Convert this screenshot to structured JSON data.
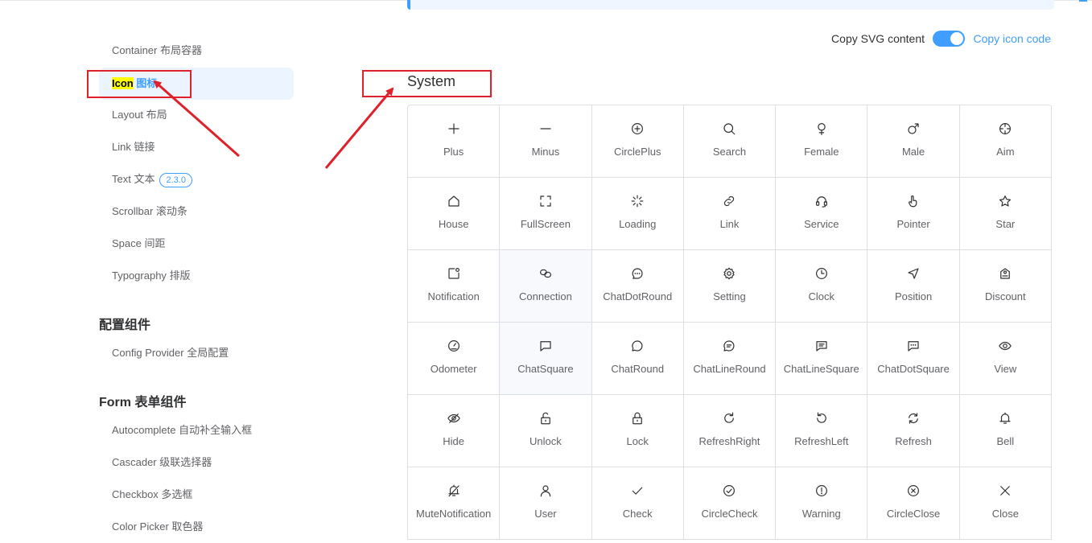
{
  "sidebar": {
    "items_top": [
      {
        "label": "Container 布局容器"
      },
      {
        "label_hl": "Icon",
        "label_rest": " 图标"
      },
      {
        "label": "Layout 布局"
      },
      {
        "label": "Link 链接"
      },
      {
        "label": "Text 文本",
        "badge": "2.3.0"
      },
      {
        "label": "Scrollbar 滚动条"
      },
      {
        "label": "Space 间距"
      },
      {
        "label": "Typography 排版"
      }
    ],
    "group_config": "配置组件",
    "config_items": [
      {
        "label": "Config Provider 全局配置"
      }
    ],
    "group_form": "Form 表单组件",
    "form_items": [
      {
        "label": "Autocomplete 自动补全输入框"
      },
      {
        "label": "Cascader 级联选择器"
      },
      {
        "label": "Checkbox 多选框"
      },
      {
        "label": "Color Picker 取色器"
      }
    ]
  },
  "copy_bar": {
    "copy_svg_label": "Copy SVG content",
    "copy_code_label": "Copy icon code",
    "toggle_on": true
  },
  "section_title": "System",
  "icons": [
    {
      "name": "Plus",
      "icon": "plus-icon"
    },
    {
      "name": "Minus",
      "icon": "minus-icon"
    },
    {
      "name": "CirclePlus",
      "icon": "circle-plus-icon"
    },
    {
      "name": "Search",
      "icon": "search-icon"
    },
    {
      "name": "Female",
      "icon": "female-icon"
    },
    {
      "name": "Male",
      "icon": "male-icon"
    },
    {
      "name": "Aim",
      "icon": "aim-icon"
    },
    {
      "name": "House",
      "icon": "house-icon"
    },
    {
      "name": "FullScreen",
      "icon": "fullscreen-icon"
    },
    {
      "name": "Loading",
      "icon": "loading-icon"
    },
    {
      "name": "Link",
      "icon": "link-icon"
    },
    {
      "name": "Service",
      "icon": "service-icon"
    },
    {
      "name": "Pointer",
      "icon": "pointer-icon"
    },
    {
      "name": "Star",
      "icon": "star-icon"
    },
    {
      "name": "Notification",
      "icon": "notification-icon"
    },
    {
      "name": "Connection",
      "icon": "connection-icon"
    },
    {
      "name": "ChatDotRound",
      "icon": "chat-dot-round-icon"
    },
    {
      "name": "Setting",
      "icon": "setting-icon"
    },
    {
      "name": "Clock",
      "icon": "clock-icon"
    },
    {
      "name": "Position",
      "icon": "position-icon"
    },
    {
      "name": "Discount",
      "icon": "discount-icon"
    },
    {
      "name": "Odometer",
      "icon": "odometer-icon"
    },
    {
      "name": "ChatSquare",
      "icon": "chat-square-icon"
    },
    {
      "name": "ChatRound",
      "icon": "chat-round-icon"
    },
    {
      "name": "ChatLineRound",
      "icon": "chat-line-round-icon"
    },
    {
      "name": "ChatLineSquare",
      "icon": "chat-line-square-icon"
    },
    {
      "name": "ChatDotSquare",
      "icon": "chat-dot-square-icon"
    },
    {
      "name": "View",
      "icon": "view-icon"
    },
    {
      "name": "Hide",
      "icon": "hide-icon"
    },
    {
      "name": "Unlock",
      "icon": "unlock-icon"
    },
    {
      "name": "Lock",
      "icon": "lock-icon"
    },
    {
      "name": "RefreshRight",
      "icon": "refresh-right-icon"
    },
    {
      "name": "RefreshLeft",
      "icon": "refresh-left-icon"
    },
    {
      "name": "Refresh",
      "icon": "refresh-icon"
    },
    {
      "name": "Bell",
      "icon": "bell-icon"
    },
    {
      "name": "MuteNotification",
      "icon": "mute-notification-icon"
    },
    {
      "name": "User",
      "icon": "user-icon"
    },
    {
      "name": "Check",
      "icon": "check-icon"
    },
    {
      "name": "CircleCheck",
      "icon": "circle-check-icon"
    },
    {
      "name": "Warning",
      "icon": "warning-icon"
    },
    {
      "name": "CircleClose",
      "icon": "circle-close-icon"
    },
    {
      "name": "Close",
      "icon": "close-icon"
    }
  ],
  "colors": {
    "accent": "#409eff",
    "annotation_red": "#e0202a",
    "highlight_yellow": "#ffff00"
  }
}
